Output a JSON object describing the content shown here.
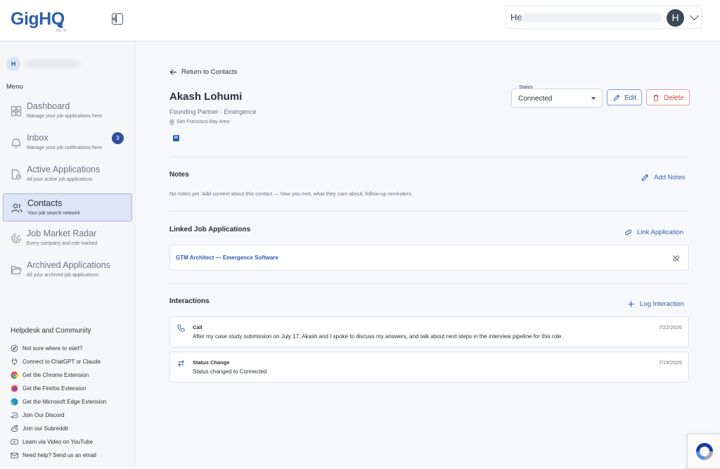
{
  "app": {
    "logo": "GigHQ",
    "logo_tag": "BETA"
  },
  "header": {
    "greeting": "He",
    "avatar_initial": "H"
  },
  "sidebar": {
    "user_initial": "H",
    "menu_label": "Menu",
    "items": [
      {
        "title": "Dashboard",
        "subtitle": "Manage your job applications here",
        "icon": "grid-icon"
      },
      {
        "title": "Inbox",
        "subtitle": "Manage your job notifications here",
        "icon": "bell-icon",
        "badge": "3"
      },
      {
        "title": "Active Applications",
        "subtitle": "All your active job applications",
        "icon": "file-clock-icon"
      },
      {
        "title": "Contacts",
        "subtitle": "Your job search network",
        "icon": "users-icon",
        "active": true
      },
      {
        "title": "Job Market Radar",
        "subtitle": "Every company and role tracked",
        "icon": "radar-icon"
      },
      {
        "title": "Archived Applications",
        "subtitle": "All your archived job applications",
        "icon": "folder-icon"
      }
    ],
    "help_title": "Helpdesk and Community",
    "help_items": [
      {
        "label": "Not sure where to start?",
        "icon": "compass-icon"
      },
      {
        "label": "Connect to ChatGPT or Claude",
        "icon": "plug-icon"
      },
      {
        "label": "Get the Chrome Extension",
        "icon": "chrome-icon"
      },
      {
        "label": "Get the Firefox Extension",
        "icon": "firefox-icon"
      },
      {
        "label": "Get the Microsoft Edge Extension",
        "icon": "edge-icon"
      },
      {
        "label": "Join Our Discord",
        "icon": "discord-icon"
      },
      {
        "label": "Join our Subreddit",
        "icon": "reddit-icon"
      },
      {
        "label": "Learn via Video on YouTube",
        "icon": "youtube-icon"
      },
      {
        "label": "Need help? Send us an email",
        "icon": "mail-icon"
      }
    ]
  },
  "contact": {
    "back_label": "Return to Contacts",
    "name": "Akash Lohumi",
    "role": "Founding Partner · Emergence",
    "location": "San Francisco Bay Area",
    "linkedin_label": "in",
    "status_label": "Status",
    "status_value": "Connected",
    "edit_label": "Edit",
    "delete_label": "Delete"
  },
  "notes": {
    "title": "Notes",
    "action": "Add Notes",
    "empty": "No notes yet. Add context about this contact — how you met, what they care about, follow-up reminders."
  },
  "linked_apps": {
    "title": "Linked Job Applications",
    "action": "Link Application",
    "items": [
      {
        "label": "GTM Architect — Emergence Software"
      }
    ]
  },
  "interactions": {
    "title": "Interactions",
    "action": "Log Interaction",
    "items": [
      {
        "type": "Call",
        "description": "After my case study submission on July 17, Akash and I spoke to discuss my answers, and talk about next steps in the interview pipeline for this role.",
        "date": "7/22/2026",
        "icon": "phone-icon"
      },
      {
        "type": "Status Change",
        "description": "Status changed to Connected",
        "date": "7/19/2026",
        "icon": "swap-icon"
      }
    ]
  },
  "colors": {
    "accent": "#2f5fae",
    "danger": "#d64545",
    "active_bg": "#dde6f6"
  }
}
